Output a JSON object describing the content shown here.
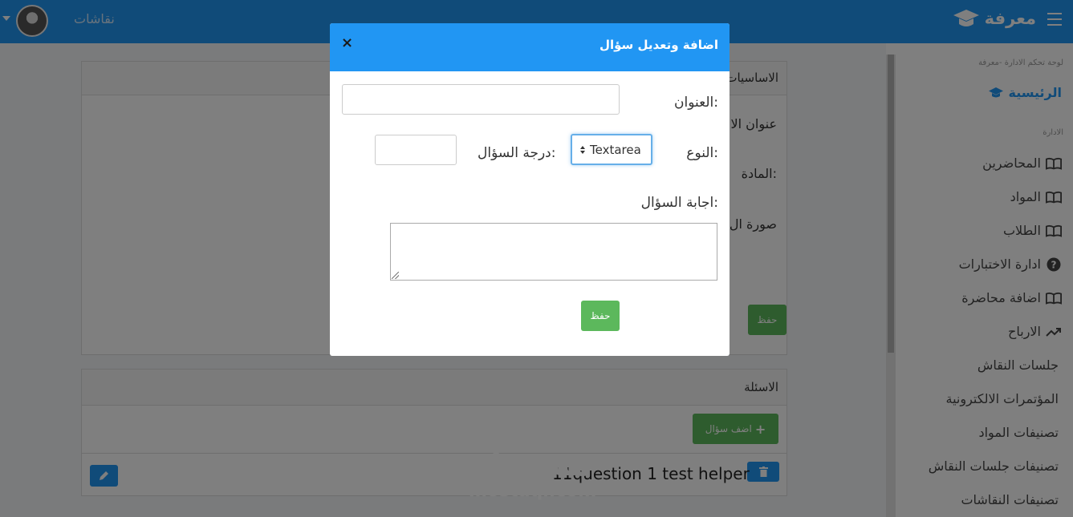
{
  "navbar": {
    "brand": "معرفة",
    "nav_link": "نقاشات"
  },
  "sidebar": {
    "breadcrumb": "لوحة تحكم الادارة -معرفة",
    "home": "الرئيسية",
    "section_caption": "الادارة",
    "items": [
      {
        "label": "المحاضرين",
        "icon": "book-icon"
      },
      {
        "label": "المواد",
        "icon": "book-icon"
      },
      {
        "label": "الطلاب",
        "icon": "book-icon"
      },
      {
        "label": "ادارة الاختبارات",
        "icon": "question-circle-icon"
      },
      {
        "label": "اضافة محاضرة",
        "icon": "book-icon"
      },
      {
        "label": "الارباح",
        "icon": "trend-up-icon"
      },
      {
        "label": "جلسات النقاش",
        "icon": ""
      },
      {
        "label": "المؤتمرات الالكترونية",
        "icon": ""
      },
      {
        "label": "تصنيفات المواد",
        "icon": ""
      },
      {
        "label": "تصنيفات جلسات النقاش",
        "icon": ""
      },
      {
        "label": "تصنيفات النقاشات",
        "icon": ""
      }
    ]
  },
  "main": {
    "basics_header": "الاساسيات",
    "exam_title_label": "عنوان الا",
    "subject_label": "المادة:",
    "image_label": "صورة ال",
    "save_label": "حفظ",
    "questions_header": "الاسئلة",
    "add_question_label": "اضف سؤال",
    "question_text": "11question 1 test helper"
  },
  "modal": {
    "title": "اضافة وتعديل سؤال",
    "close": "×",
    "title_label": "العنوان:",
    "type_label": "النوع:",
    "type_value": "Textarea",
    "grade_label": "درجة السؤال:",
    "answer_label": "اجابة السؤال:",
    "save_label": "حفظ"
  },
  "watermark": {
    "arabic": "مستقل",
    "latin": "mostaql.com"
  },
  "colors": {
    "primary": "#2196f3",
    "success": "#5cb85c"
  }
}
